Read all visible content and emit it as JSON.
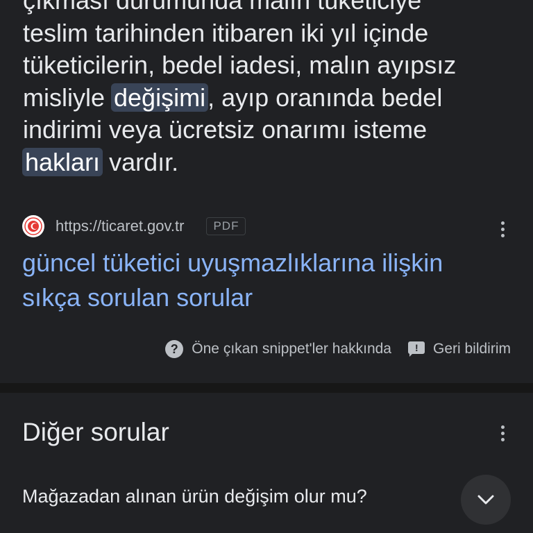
{
  "snippet": {
    "lines": [
      {
        "before": "çıkması durumunda malın tüketiciye",
        "highlight": "",
        "after": ""
      },
      {
        "before": "teslim tarihinden itibaren iki yıl içinde",
        "highlight": "",
        "after": ""
      },
      {
        "before": "tüketicilerin, bedel iadesi, malın ayıpsız",
        "highlight": "",
        "after": ""
      },
      {
        "before": "misliyle ",
        "highlight": "değişimi",
        "after": ", ayıp oranında bedel"
      },
      {
        "before": "indirimi veya ücretsiz onarımı isteme",
        "highlight": "",
        "after": ""
      },
      {
        "before": "",
        "highlight": "hakları",
        "after": " vardır."
      }
    ]
  },
  "source": {
    "url": "https://ticaret.gov.tr",
    "badge": "PDF",
    "favicon_icon": "turkish-crescent-seal-icon"
  },
  "result_title": {
    "line1": "güncel tüketici uyuşmazlıklarına ilişkin",
    "line2": "sıkça sorulan sorular"
  },
  "footer": {
    "about_label": "Öne çıkan snippet'ler hakkında",
    "feedback_label": "Geri bildirim"
  },
  "other_questions": {
    "title": "Diğer sorular",
    "items": [
      {
        "question": "Mağazadan alınan ürün değişim olur mu?"
      }
    ]
  },
  "colors": {
    "background": "#202124",
    "link": "#8ab4f8",
    "highlight": "#394457",
    "text": "#e8eaed",
    "secondary_text": "#bdc1c6"
  }
}
